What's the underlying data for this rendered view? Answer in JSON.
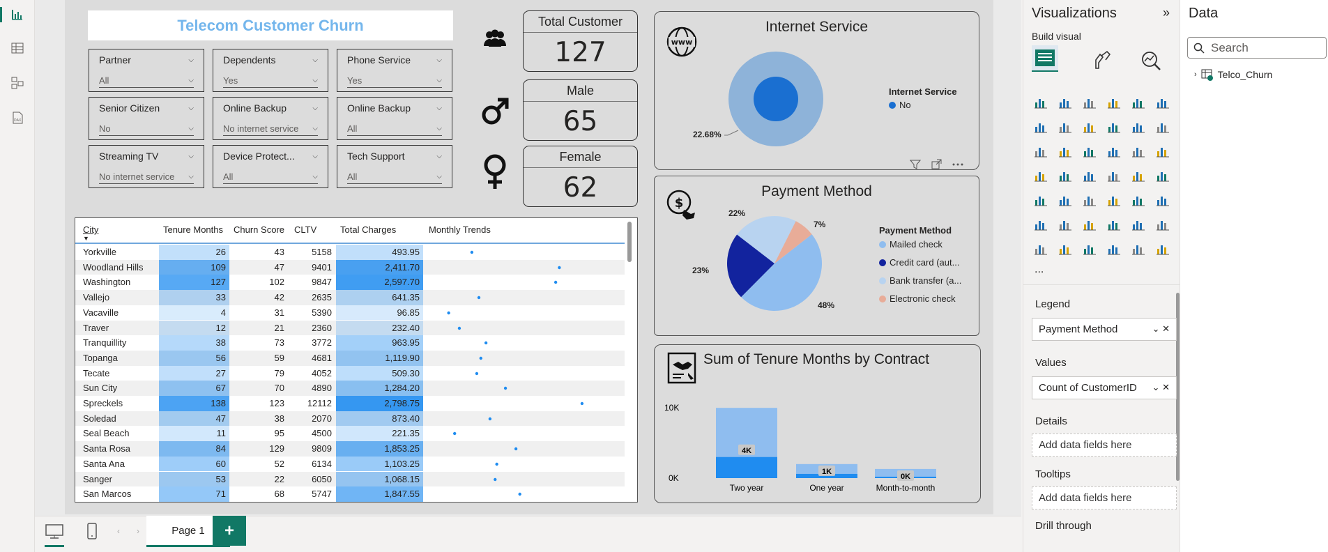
{
  "title": "Telecom Customer Churn",
  "slicers": [
    {
      "label": "Partner",
      "value": "All"
    },
    {
      "label": "Dependents",
      "value": "Yes"
    },
    {
      "label": "Phone Service",
      "value": "Yes"
    },
    {
      "label": "Senior Citizen",
      "value": "No"
    },
    {
      "label": "Online Backup",
      "value": "No internet service"
    },
    {
      "label": "Online Backup",
      "value": "All"
    },
    {
      "label": "Streaming TV",
      "value": "No internet service"
    },
    {
      "label": "Device Protect...",
      "value": "All"
    },
    {
      "label": "Tech Support",
      "value": "All"
    }
  ],
  "cards": {
    "total": {
      "label": "Total Customer",
      "value": "127"
    },
    "male": {
      "label": "Male",
      "value": "65"
    },
    "female": {
      "label": "Female",
      "value": "62"
    }
  },
  "internet": {
    "title": "Internet Service",
    "legend_title": "Internet Service",
    "legend": [
      {
        "name": "No",
        "color": "#1a6fd1"
      }
    ],
    "pct_label": "22.68%"
  },
  "payment": {
    "title": "Payment Method",
    "legend_title": "Payment Method",
    "legend": [
      {
        "name": "Mailed check",
        "color": "#8fbdef"
      },
      {
        "name": "Credit card (aut...",
        "color": "#12239e"
      },
      {
        "name": "Bank transfer (a...",
        "color": "#b8d3f0"
      },
      {
        "name": "Electronic check",
        "color": "#e8ac98"
      }
    ],
    "labels": {
      "p48": "48%",
      "p23": "23%",
      "p22": "22%",
      "p7": "7%"
    }
  },
  "contract": {
    "title": "Sum of Tenure Months by Contract",
    "y_ticks": [
      "10K",
      "0K"
    ],
    "bar_labels": [
      "4K",
      "1K",
      "0K"
    ]
  },
  "chart_data": [
    {
      "type": "pie",
      "title": "Internet Service",
      "categories": [
        "No"
      ],
      "values": [
        100
      ],
      "annotation": "22.68%"
    },
    {
      "type": "pie",
      "title": "Payment Method",
      "categories": [
        "Mailed check",
        "Credit card (aut...",
        "Bank transfer (a...",
        "Electronic check"
      ],
      "values": [
        48,
        23,
        22,
        7
      ]
    },
    {
      "type": "bar",
      "title": "Sum of Tenure Months by Contract",
      "categories": [
        "Two year",
        "One year",
        "Month-to-month"
      ],
      "series": [
        {
          "values": [
            10000,
            2000,
            1300
          ]
        },
        {
          "values": [
            3000,
            600,
            200
          ]
        }
      ],
      "data_labels": [
        "4K",
        "1K",
        "0K"
      ],
      "ylim": [
        0,
        10000
      ],
      "y_ticks": [
        "10K",
        "0K"
      ]
    }
  ],
  "table": {
    "columns": [
      "City",
      "Tenure Months",
      "Churn Score",
      "CLTV",
      "Total Charges",
      "Monthly Trends"
    ],
    "rows": [
      [
        "Yorkville",
        "26",
        "43",
        "5158",
        "493.95"
      ],
      [
        "Woodland Hills",
        "109",
        "47",
        "9401",
        "2,411.70"
      ],
      [
        "Washington",
        "127",
        "102",
        "9847",
        "2,597.70"
      ],
      [
        "Vallejo",
        "33",
        "42",
        "2635",
        "641.35"
      ],
      [
        "Vacaville",
        "4",
        "31",
        "5390",
        "96.85"
      ],
      [
        "Traver",
        "12",
        "21",
        "2360",
        "232.40"
      ],
      [
        "Tranquillity",
        "38",
        "73",
        "3772",
        "963.95"
      ],
      [
        "Topanga",
        "56",
        "59",
        "4681",
        "1,119.90"
      ],
      [
        "Tecate",
        "27",
        "79",
        "4052",
        "509.30"
      ],
      [
        "Sun City",
        "67",
        "70",
        "4890",
        "1,284.20"
      ],
      [
        "Spreckels",
        "138",
        "123",
        "12112",
        "2,798.75"
      ],
      [
        "Soledad",
        "47",
        "38",
        "2070",
        "873.40"
      ],
      [
        "Seal Beach",
        "11",
        "95",
        "4500",
        "221.35"
      ],
      [
        "Santa Rosa",
        "84",
        "129",
        "9809",
        "1,853.25"
      ],
      [
        "Santa Ana",
        "60",
        "52",
        "6134",
        "1,103.25"
      ],
      [
        "Sanger",
        "53",
        "22",
        "6050",
        "1,068.15"
      ],
      [
        "San Marcos",
        "71",
        "68",
        "5747",
        "1,847.55"
      ]
    ]
  },
  "footer": {
    "page_tab": "Page 1",
    "add": "+"
  },
  "vis_pane": {
    "title": "Visualizations",
    "build": "Build visual",
    "more": "...",
    "legend_label": "Legend",
    "legend_field": "Payment Method",
    "values_label": "Values",
    "values_field": "Count of CustomerID",
    "details_label": "Details",
    "tooltips_label": "Tooltips",
    "add_fields": "Add data fields here",
    "drill": "Drill through"
  },
  "data_pane": {
    "title": "Data",
    "search_placeholder": "Search",
    "table": "Telco_Churn"
  }
}
